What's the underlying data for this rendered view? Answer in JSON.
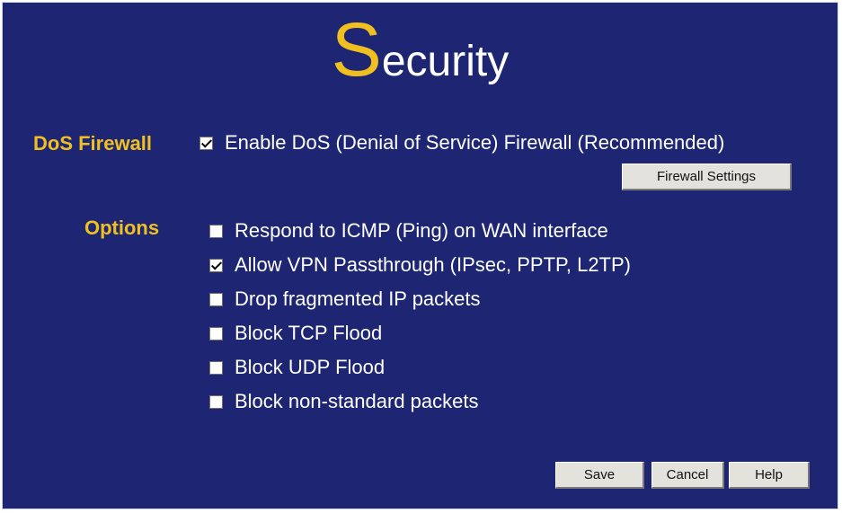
{
  "title": {
    "first_letter": "S",
    "rest": "ecurity"
  },
  "dos_firewall": {
    "label": "DoS Firewall",
    "enable": {
      "label": "Enable DoS (Denial of Service) Firewall (Recommended)",
      "checked": true
    },
    "settings_button": "Firewall Settings"
  },
  "options": {
    "label": "Options",
    "items": [
      {
        "label": "Respond to ICMP (Ping) on WAN interface",
        "checked": false
      },
      {
        "label": "Allow VPN Passthrough (IPsec, PPTP, L2TP)",
        "checked": true
      },
      {
        "label": "Drop fragmented IP packets",
        "checked": false
      },
      {
        "label": "Block TCP Flood",
        "checked": false
      },
      {
        "label": "Block UDP Flood",
        "checked": false
      },
      {
        "label": "Block non-standard packets",
        "checked": false
      }
    ]
  },
  "buttons": {
    "save": "Save",
    "cancel": "Cancel",
    "help": "Help"
  }
}
